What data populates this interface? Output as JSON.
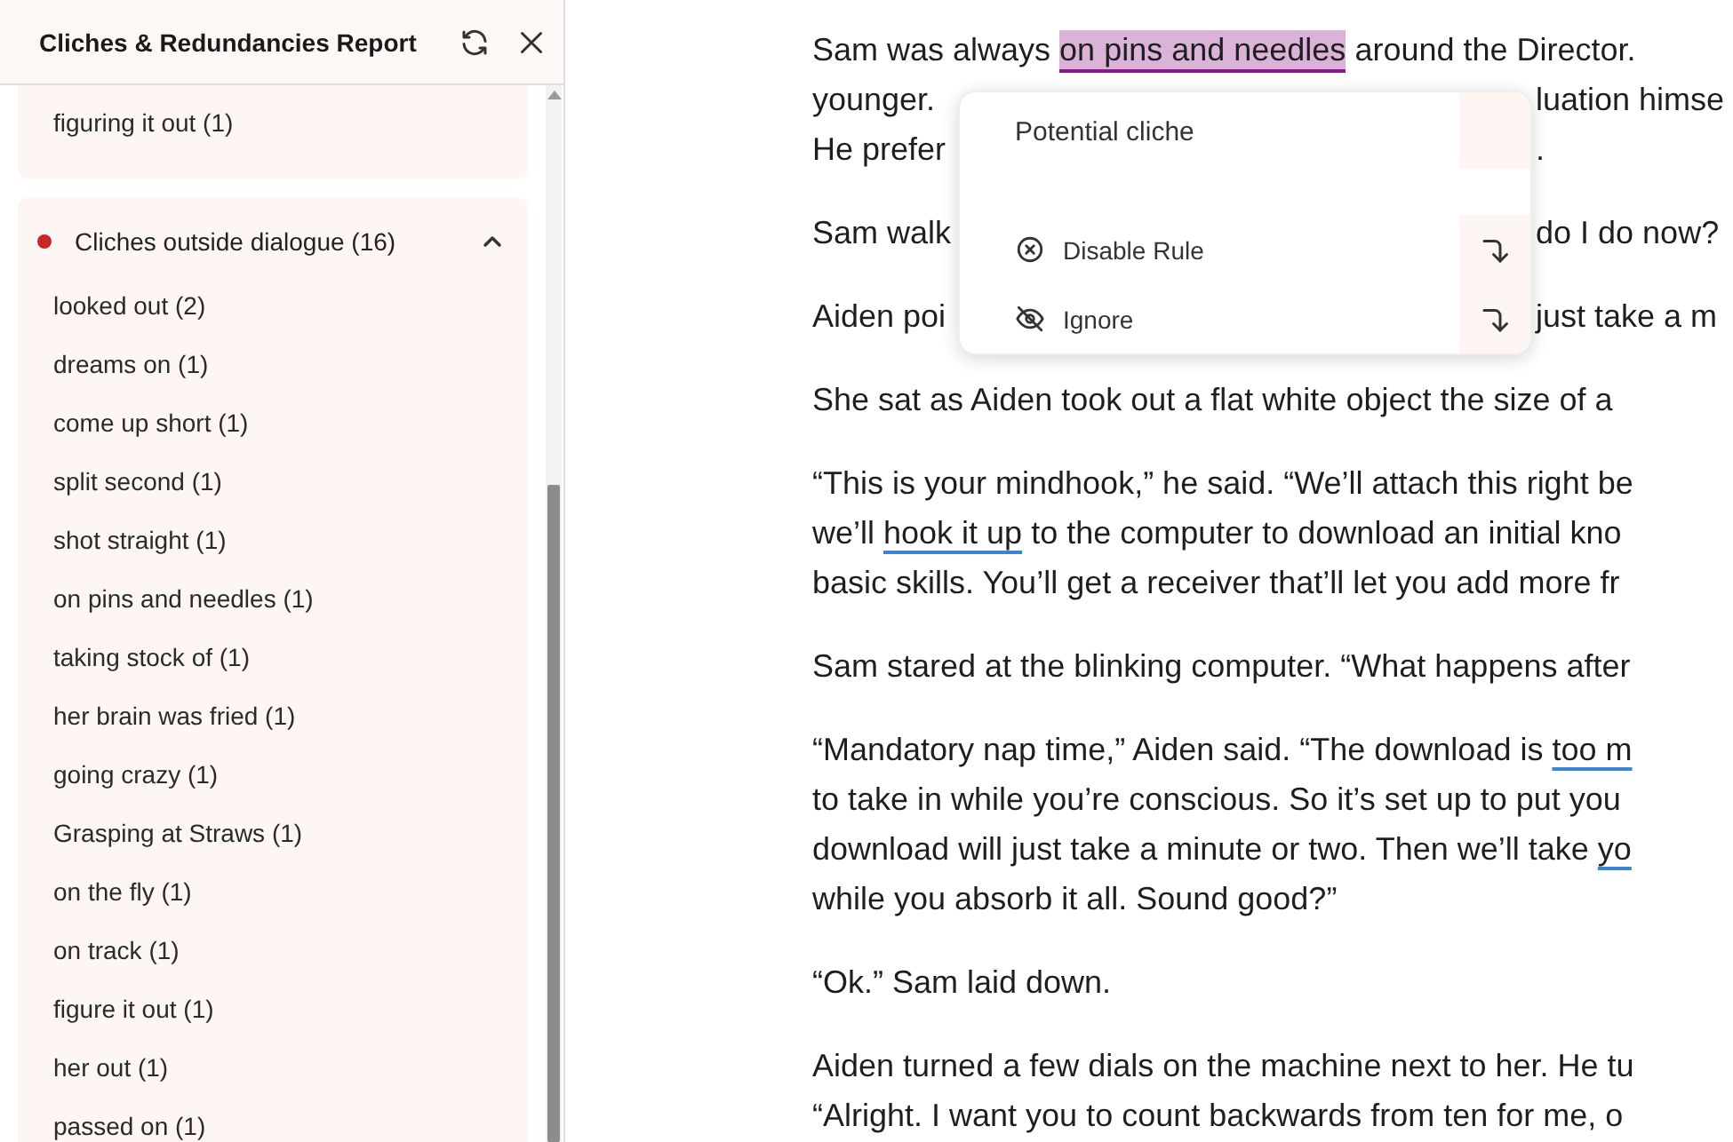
{
  "panel": {
    "title": "Cliches & Redundancies Report",
    "sections": [
      {
        "items": [
          "figuring it out (1)"
        ]
      },
      {
        "label": "Cliches outside dialogue (16)",
        "color": "#c62828",
        "expanded": true,
        "items": [
          "looked out (2)",
          "dreams on (1)",
          "come up short (1)",
          "split second (1)",
          "shot straight (1)",
          "on pins and needles (1)",
          "taking stock of (1)",
          "her brain was fried (1)",
          "going crazy (1)",
          "Grasping at Straws (1)",
          "on the fly (1)",
          "on track (1)",
          "figure it out (1)",
          "her out (1)",
          "passed on (1)"
        ]
      }
    ]
  },
  "document": {
    "paragraphs": [
      {
        "lines": [
          {
            "left": [
              "Sam was always ",
              {
                "kind": "cliche",
                "text": "on pins and needles"
              },
              " around the Director."
            ]
          },
          {
            "left": [
              "younger."
            ],
            "right": [
              "luation himse"
            ]
          },
          {
            "left": [
              "He prefer"
            ],
            "right": [
              "."
            ]
          }
        ]
      },
      {
        "lines": [
          {
            "left": [
              "Sam walk"
            ],
            "right": [
              "do I do now?"
            ]
          }
        ]
      },
      {
        "lines": [
          {
            "left": [
              "Aiden poi"
            ],
            "right": [
              "just take a m"
            ]
          }
        ]
      },
      {
        "lines": [
          {
            "left": [
              "She sat as Aiden took out a flat white object the size of a"
            ]
          }
        ]
      },
      {
        "lines": [
          {
            "left": [
              "“This is your mindhook,” he said. “We’ll attach this right be"
            ]
          },
          {
            "left": [
              "we’ll ",
              {
                "kind": "flag",
                "text": "hook it up"
              },
              " to the computer to download an initial kno"
            ]
          },
          {
            "left": [
              "basic skills. You’ll get a receiver that’ll let you add more fr"
            ]
          }
        ]
      },
      {
        "lines": [
          {
            "left": [
              "Sam stared at the blinking computer. “What happens after"
            ]
          }
        ]
      },
      {
        "lines": [
          {
            "left": [
              "“Mandatory nap time,” Aiden said. “The download is ",
              {
                "kind": "flag",
                "text": "too m"
              }
            ]
          },
          {
            "left": [
              "to take in while you’re conscious. So it’s set up to put you"
            ]
          },
          {
            "left": [
              "download will just take a minute or two. Then we’ll take ",
              {
                "kind": "flag",
                "text": "yo"
              }
            ]
          },
          {
            "left": [
              "while you absorb it all. Sound good?”"
            ]
          }
        ]
      },
      {
        "lines": [
          {
            "left": [
              "“Ok.” Sam laid down."
            ]
          }
        ]
      },
      {
        "lines": [
          {
            "left": [
              "Aiden turned a few dials on the machine next to her. He tu"
            ]
          },
          {
            "left": [
              "“Alright. I want you to count backwards from ten for me, o"
            ]
          }
        ]
      }
    ]
  },
  "popup": {
    "title": "Potential cliche",
    "actions": [
      {
        "kind": "disable",
        "label": "Disable Rule"
      },
      {
        "kind": "ignore",
        "label": "Ignore"
      }
    ]
  }
}
